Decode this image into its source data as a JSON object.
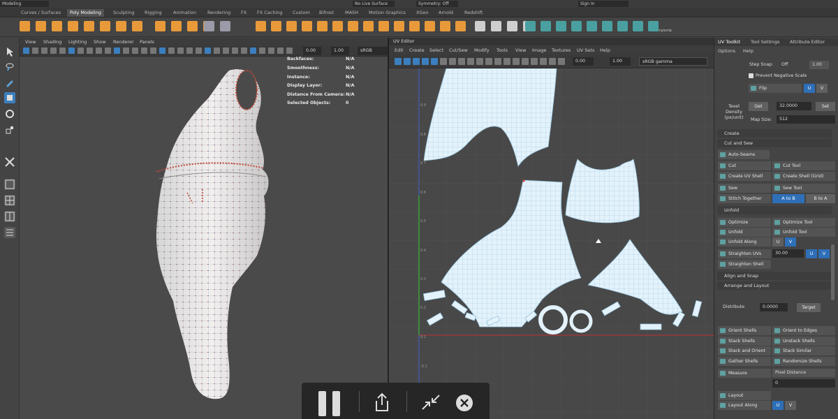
{
  "topbar": {
    "workspace": "Modeling",
    "symmetry": "Symmetry: Off",
    "live_surface": "No Live Surface",
    "signin": "Sign In"
  },
  "shelf_tabs": [
    "Curves / Surfaces",
    "Poly Modeling",
    "Sculpting",
    "Rigging",
    "Animation",
    "Rendering",
    "FX",
    "FX Caching",
    "Custom",
    "Bifrost",
    "MASH",
    "Motion Graphics",
    "XGen",
    "Arnold",
    "Redshift"
  ],
  "shelf_active": "Poly Modeling",
  "shelf_misc_label": "myscrip",
  "viewport": {
    "menu": [
      "View",
      "Shading",
      "Lighting",
      "Show",
      "Renderer",
      "Panels"
    ],
    "field1": "0.00",
    "field2": "1.00",
    "colorspace": "sRGB gamma",
    "hud": [
      {
        "label": "Backfaces:",
        "value": "N/A"
      },
      {
        "label": "Smoothness:",
        "value": "N/A"
      },
      {
        "label": "Instance:",
        "value": "N/A"
      },
      {
        "label": "Display Layer:",
        "value": "N/A"
      },
      {
        "label": "Distance From Camera:",
        "value": "N/A"
      },
      {
        "label": "Selected Objects:",
        "value": "0"
      }
    ]
  },
  "uv_editor": {
    "title": "UV Editor",
    "menu": [
      "Edit",
      "Create",
      "Select",
      "Cut/Sew",
      "Modify",
      "Tools",
      "View",
      "Image",
      "Textures",
      "UV Sets",
      "Help"
    ],
    "field1": "0.00",
    "field2": "1.00",
    "colorspace": "sRGB gamma",
    "axis_labels": [
      "0.9",
      "0.8",
      "0.7",
      "0.6",
      "0.5",
      "0.4",
      "0.3",
      "0.2",
      "0.1",
      "-0.1"
    ]
  },
  "right_panel": {
    "tabs": [
      "UV Toolkit",
      "Tool Settings",
      "Attribute Editor"
    ],
    "menu": [
      "Options",
      "Help"
    ],
    "step_snap_label": "Step Snap:",
    "step_snap_value": "Off",
    "step_snap_num": "1.00",
    "prevent_negative": "Prevent Negative Scale",
    "flip": "Flip",
    "u": "U",
    "v": "V",
    "texel_density": "Texel Density (px/unit)",
    "get": "Get",
    "texel_value": "32.0000",
    "set": "Set",
    "map_size_label": "Map Size:",
    "map_size_value": "512",
    "sections": {
      "create": "Create",
      "cut_and_sew": "Cut and Sew",
      "unfold": "Unfold",
      "align_and_snap": "Align and Snap",
      "arrange_and_layout": "Arrange and Layout"
    },
    "cut_sew": [
      "Auto-Seams",
      "Cut",
      "Cut Tool",
      "Create UV Shell",
      "Create Shell (Grid)",
      "Sew",
      "Sew Tool",
      "Stitch Together"
    ],
    "a_to_b": "A to B",
    "b_to_a": "B to A",
    "unfold_btns": [
      "Optimize",
      "Optimize Tool",
      "Unfold",
      "Unfold Tool",
      "Unfold Along",
      "Straighten UVs",
      "Straighten Shell"
    ],
    "straighten_value": "30.00",
    "distribute": "Distribute",
    "distribute_value": "0.0000",
    "target": "Target",
    "arrange_btns": [
      "Orient Shells",
      "Orient to Edges",
      "Stack Shells",
      "Unstack Shells",
      "Stack and Orient",
      "Stack Similar",
      "Gather Shells",
      "Randomize Shells"
    ],
    "measure": "Measure",
    "measure_mode": "Pixel Distance",
    "measure_value": "0",
    "layout": "Layout",
    "layout_along": "Layout Along"
  },
  "colors": {
    "accent_blue": "#2e6fb8",
    "uv_shell": "#e3f2fb",
    "uv_line": "#8fbfdc",
    "selected_tool": "#3b7fbf"
  }
}
